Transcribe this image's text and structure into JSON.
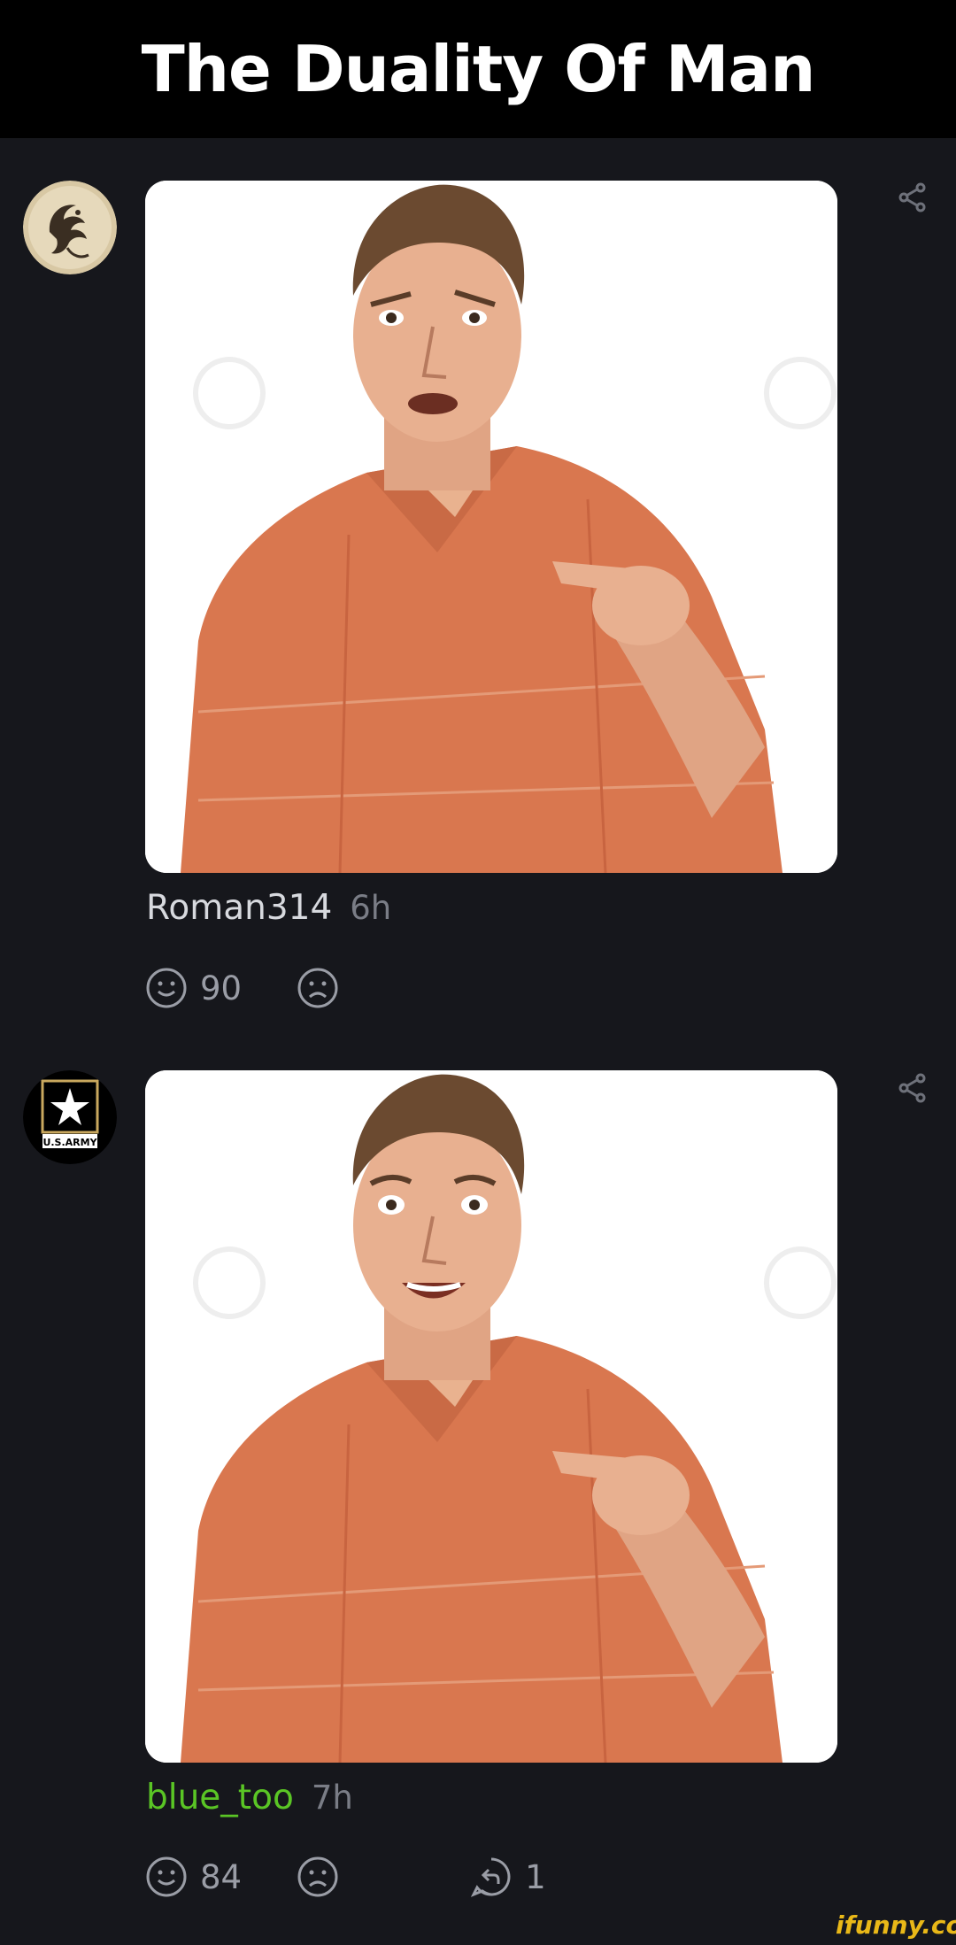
{
  "header": {
    "title": "The Duality Of Man"
  },
  "comments": [
    {
      "username": "Roman314",
      "time": "6h",
      "smile_count": "90",
      "frown_count": "",
      "reply_count": "",
      "avatar_icon": "phoenix-avatar-icon",
      "expression": "frown"
    },
    {
      "username": "blue_too",
      "time": "7h",
      "smile_count": "84",
      "frown_count": "",
      "reply_count": "1",
      "avatar_icon": "us-army-avatar-icon",
      "expression": "smile",
      "username_color": "#5ac525"
    }
  ],
  "army_logo_text": "U.S.ARMY",
  "watermark": "ifunny.co",
  "colors": {
    "background": "#16171c",
    "title_bar": "#000000",
    "shirt": "#d9774f",
    "accent_green": "#5ac525",
    "watermark": "#e9b818"
  }
}
